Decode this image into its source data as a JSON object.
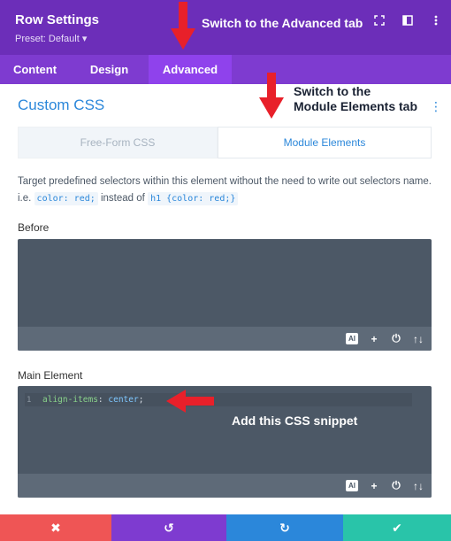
{
  "header": {
    "title": "Row Settings",
    "preset": "Preset: Default ▾",
    "icons": [
      "expand-icon",
      "sidebar-icon",
      "more-icon"
    ]
  },
  "tabs": [
    {
      "label": "Content"
    },
    {
      "label": "Design"
    },
    {
      "label": "Advanced",
      "active": true
    }
  ],
  "section": {
    "title": "Custom CSS",
    "subtabs": [
      {
        "label": "Free-Form CSS"
      },
      {
        "label": "Module Elements",
        "active": true
      }
    ],
    "description_part1": "Target predefined selectors within this element without the need to write out selectors name. i.e.",
    "code1": "color: red;",
    "description_part2": "instead of",
    "code2": "h1 {color: red;}"
  },
  "fields": {
    "before_label": "Before",
    "main_label": "Main Element",
    "main_code": {
      "line_number": "1",
      "property": "align-items",
      "colon": ":",
      "value": "center",
      "semicolon": ";"
    },
    "toolbar": {
      "ai_label": "AI",
      "add": "+",
      "power": "⏻",
      "sort": "↑↓"
    }
  },
  "footer": {
    "discard": "✖",
    "undo": "↺",
    "redo": "↻",
    "save": "✔"
  },
  "annotations": {
    "switch_advanced": "Switch to the Advanced tab",
    "switch_module_line1": "Switch to the",
    "switch_module_line2": "Module Elements tab",
    "add_snippet": "Add this CSS snippet"
  },
  "colors": {
    "header": "#6c2eb9",
    "tabs": "#7e3bd0",
    "active_tab": "#8f42ec",
    "accent": "#2b87da",
    "editor": "#4c5866",
    "arrow": "#e8202a"
  }
}
